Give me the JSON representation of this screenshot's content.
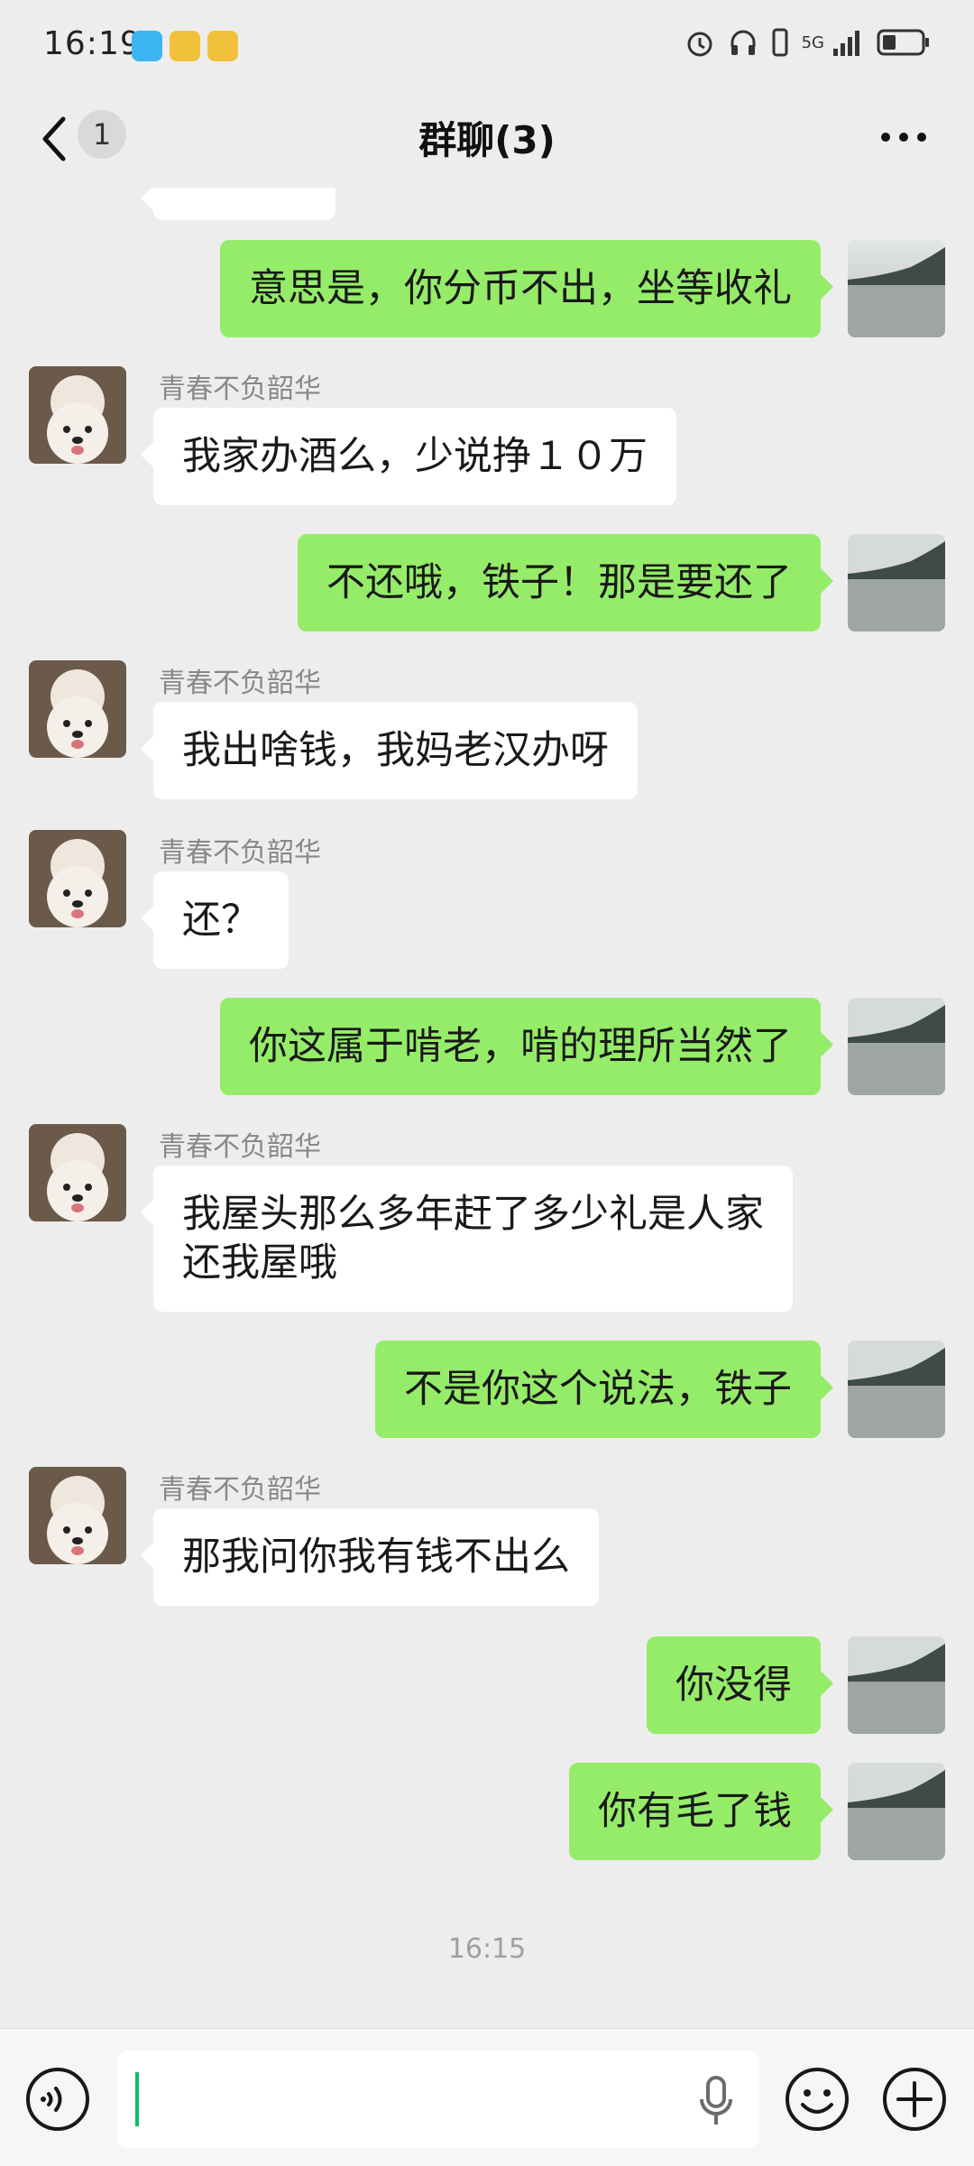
{
  "status_bar": {
    "time": "16:19",
    "network": "5G"
  },
  "nav": {
    "unread_count": "1",
    "title": "群聊(3)"
  },
  "sender": {
    "name": "青春不负韶华"
  },
  "messages": [
    {
      "dir": "in",
      "text": ""
    },
    {
      "dir": "out",
      "text": "意思是，你分币不出，坐等收礼"
    },
    {
      "dir": "in",
      "name": "青春不负韶华",
      "text": "我家办酒么，少说挣１０万"
    },
    {
      "dir": "out",
      "text": "不还哦，铁子！那是要还了"
    },
    {
      "dir": "in",
      "name": "青春不负韶华",
      "text": "我出啥钱，我妈老汉办呀"
    },
    {
      "dir": "in",
      "name": "青春不负韶华",
      "text": "还？"
    },
    {
      "dir": "out",
      "text": "你这属于啃老，啃的理所当然了"
    },
    {
      "dir": "in",
      "name": "青春不负韶华",
      "text_line1": "我屋头那么多年赶了多少礼是人家",
      "text_line2": "还我屋哦"
    },
    {
      "dir": "out",
      "text": "不是你这个说法，铁子"
    },
    {
      "dir": "in",
      "name": "青春不负韶华",
      "text": "那我问你我有钱不出么"
    },
    {
      "dir": "out",
      "text": "你没得"
    },
    {
      "dir": "out",
      "text": "你有毛了钱"
    }
  ],
  "timestamp": "16:15",
  "input": {
    "value": "",
    "placeholder": ""
  },
  "colors": {
    "background": "#EDEDED",
    "outgoing_bubble": "#95EC69",
    "incoming_bubble": "#FFFFFF",
    "accent": "#07C160"
  },
  "icons": [
    "back-icon",
    "more-icon",
    "voice-icon",
    "mic-icon",
    "emoji-icon",
    "plus-icon",
    "alarm-icon",
    "headphones-icon",
    "signal-icon",
    "battery-icon"
  ]
}
